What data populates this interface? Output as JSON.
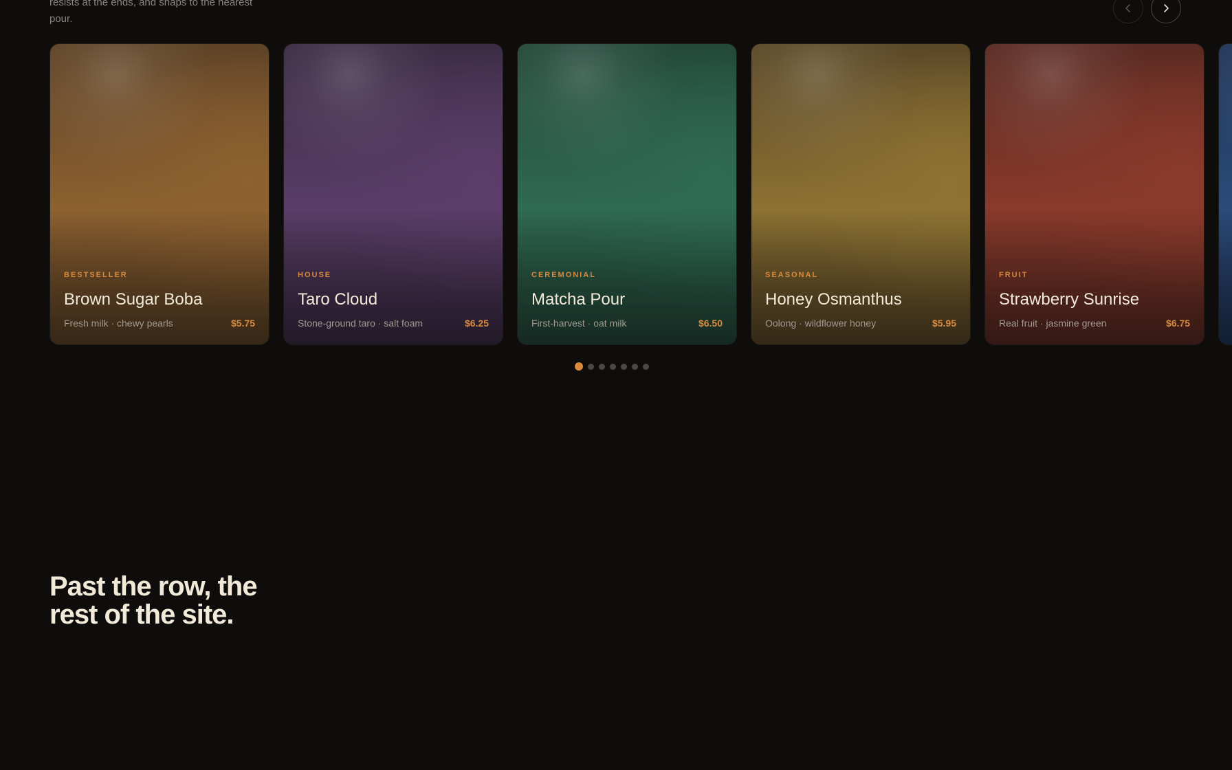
{
  "intro": {
    "text": "resists at the ends, and snaps to the nearest pour."
  },
  "nav": {
    "prev_icon": "chevron-left-icon",
    "next_icon": "chevron-right-icon"
  },
  "cards": [
    {
      "tag": "BESTSELLER",
      "name": "Brown Sugar Boba",
      "desc": "Fresh milk · chewy pearls",
      "price": "$5.75",
      "color_top": "#5e4327",
      "color_mid": "#8d6130",
      "color_bot": "#5e4327"
    },
    {
      "tag": "HOUSE",
      "name": "Taro Cloud",
      "desc": "Stone-ground taro · salt foam",
      "price": "$6.25",
      "color_top": "#3b2c45",
      "color_mid": "#5a3d68",
      "color_bot": "#3b2c45"
    },
    {
      "tag": "CEREMONIAL",
      "name": "Matcha Pour",
      "desc": "First-harvest · oat milk",
      "price": "$6.50",
      "color_top": "#24483a",
      "color_mid": "#2f6a52",
      "color_bot": "#24483a"
    },
    {
      "tag": "SEASONAL",
      "name": "Honey Osmanthus",
      "desc": "Oolong · wildflower honey",
      "price": "$5.95",
      "color_top": "#5a4727",
      "color_mid": "#8d7233",
      "color_bot": "#5a4727"
    },
    {
      "tag": "FRUIT",
      "name": "Strawberry Sunrise",
      "desc": "Real fruit · jasmine green",
      "price": "$6.75",
      "color_top": "#5a2a22",
      "color_mid": "#8a3a2c",
      "color_bot": "#5a2a22"
    },
    {
      "tag": "",
      "name": "",
      "desc": "",
      "price": "",
      "color_top": "#1f3557",
      "color_mid": "#2c4b7a",
      "color_bot": "#1f3557"
    }
  ],
  "pagination": {
    "count": 7,
    "active_index": 0
  },
  "colors": {
    "accent": "#d98a3d",
    "background": "#0e0d0c",
    "heading": "#f2ead9"
  },
  "section": {
    "title_line1": "Past the row, the",
    "title_line2": "rest of the site."
  }
}
